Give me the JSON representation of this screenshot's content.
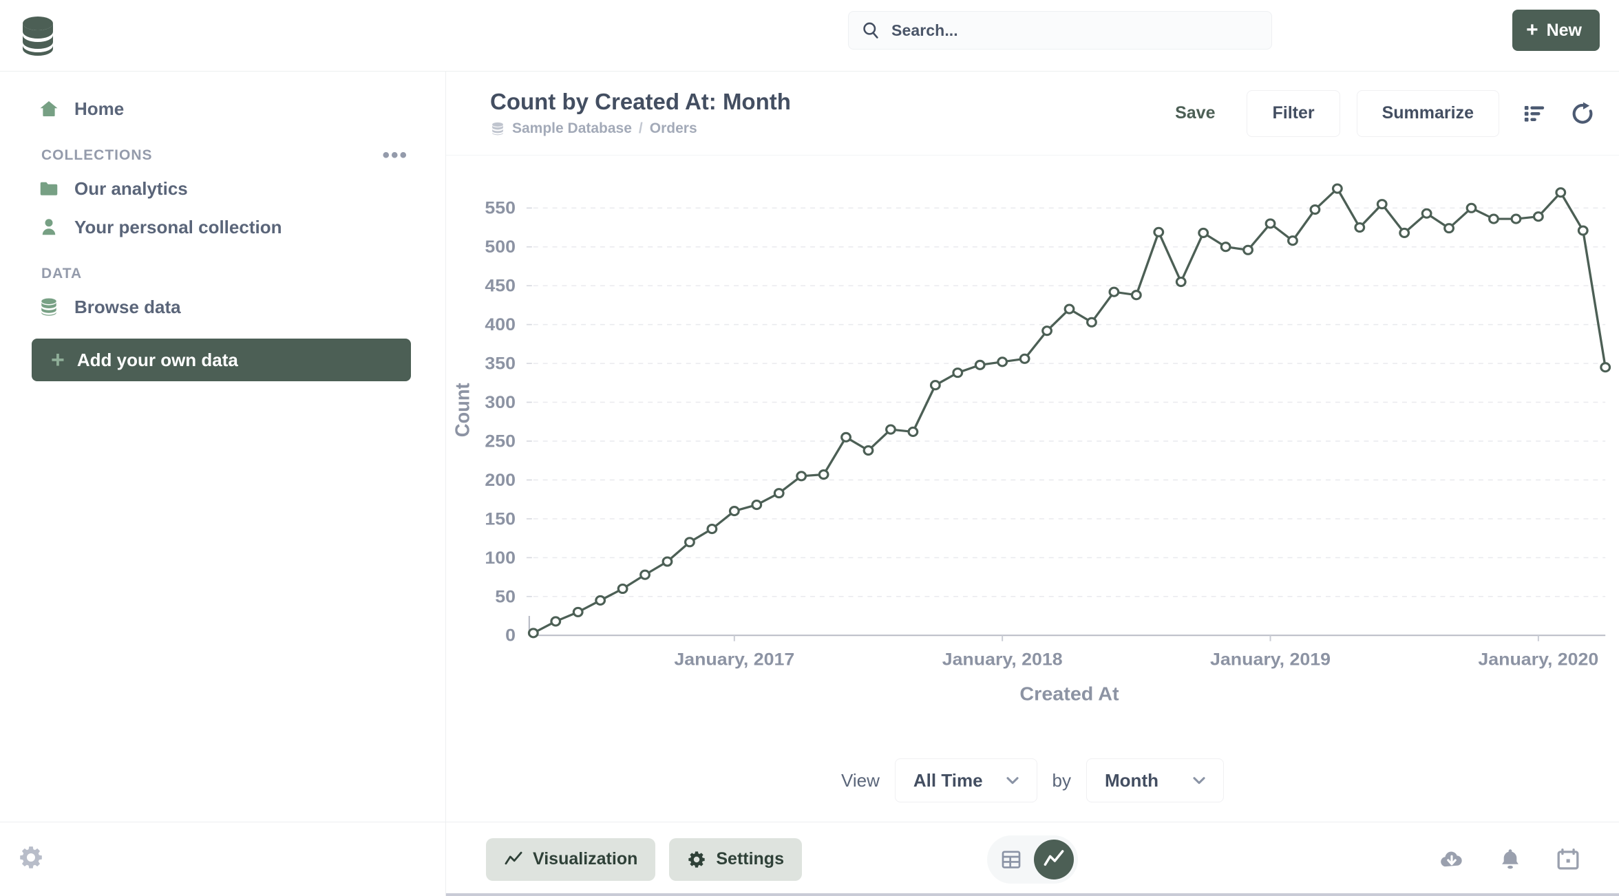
{
  "app": {
    "logo_icon": "database-logo-icon",
    "accent_color": "#4C5F55",
    "text_color": "#434E61",
    "muted_color": "#A3AAB8"
  },
  "topnav": {
    "search": {
      "placeholder": "Search...",
      "value": "",
      "icon": "search-icon"
    },
    "new_button": {
      "label": "New",
      "icon": "plus-icon"
    }
  },
  "sidebar": {
    "home": {
      "label": "Home",
      "icon": "home-icon"
    },
    "collections_section": {
      "label": "COLLECTIONS",
      "menu_icon": "ellipsis-icon"
    },
    "collections": [
      {
        "label": "Our analytics",
        "icon": "folder-icon"
      },
      {
        "label": "Your personal collection",
        "icon": "person-icon"
      }
    ],
    "data_section": {
      "label": "DATA"
    },
    "data_items": [
      {
        "label": "Browse data",
        "icon": "database-icon"
      }
    ],
    "add_data": {
      "label": "Add your own data",
      "icon": "plus-icon"
    },
    "footer": {
      "settings_icon": "gear-icon"
    }
  },
  "question": {
    "title": "Count by Created At: Month",
    "breadcrumb": {
      "icon": "database-icon",
      "database": "Sample Database",
      "separator": "/",
      "table": "Orders"
    },
    "actions": {
      "save": "Save",
      "filter": "Filter",
      "summarize": "Summarize",
      "columns_icon": "list-columns-icon",
      "refresh_icon": "refresh-icon"
    }
  },
  "view_controls": {
    "view_label": "View",
    "time_value": "All Time",
    "by_label": "by",
    "unit_value": "Month",
    "chevron_icon": "chevron-down-icon"
  },
  "footer": {
    "visualization": {
      "label": "Visualization",
      "icon": "line-chart-icon"
    },
    "settings": {
      "label": "Settings",
      "icon": "gear-icon"
    },
    "toggle": {
      "table_icon": "table-icon",
      "chart_icon": "line-chart-icon",
      "active": "chart"
    },
    "right_icons": [
      {
        "name": "download-icon"
      },
      {
        "name": "bell-icon"
      },
      {
        "name": "calendar-icon"
      }
    ]
  },
  "chart_data": {
    "type": "line",
    "title": "Count by Created At: Month",
    "xlabel": "Created At",
    "ylabel": "Count",
    "ylim": [
      0,
      580
    ],
    "yticks": [
      0,
      50,
      100,
      150,
      200,
      250,
      300,
      350,
      400,
      450,
      500,
      550
    ],
    "grid": true,
    "legend": false,
    "line_color": "#4C5F55",
    "marker": "open-circle",
    "xtick_labels": [
      "January, 2017",
      "January, 2018",
      "January, 2019",
      "January, 2020"
    ],
    "xtick_indices": [
      9,
      21,
      33,
      45
    ],
    "x": [
      "April, 2016",
      "May, 2016",
      "June, 2016",
      "July, 2016",
      "August, 2016",
      "September, 2016",
      "October, 2016",
      "November, 2016",
      "December, 2016",
      "January, 2017",
      "February, 2017",
      "March, 2017",
      "April, 2017",
      "May, 2017",
      "June, 2017",
      "July, 2017",
      "August, 2017",
      "September, 2017",
      "October, 2017",
      "November, 2017",
      "December, 2017",
      "January, 2018",
      "February, 2018",
      "March, 2018",
      "April, 2018",
      "May, 2018",
      "June, 2018",
      "July, 2018",
      "August, 2018",
      "September, 2018",
      "October, 2018",
      "November, 2018",
      "December, 2018",
      "January, 2019",
      "February, 2019",
      "March, 2019",
      "April, 2019",
      "May, 2019",
      "June, 2019",
      "July, 2019",
      "August, 2019",
      "September, 2019",
      "October, 2019",
      "November, 2019",
      "December, 2019",
      "January, 2020",
      "February, 2020",
      "March, 2020",
      "April, 2020"
    ],
    "values": [
      3,
      18,
      30,
      45,
      60,
      78,
      95,
      120,
      137,
      160,
      168,
      183,
      205,
      207,
      255,
      238,
      265,
      262,
      322,
      338,
      348,
      352,
      356,
      392,
      420,
      403,
      442,
      438,
      519,
      455,
      518,
      500,
      496,
      530,
      508,
      548,
      575,
      525,
      555,
      518,
      543,
      524,
      550,
      536,
      536,
      539,
      570,
      521,
      345
    ]
  }
}
